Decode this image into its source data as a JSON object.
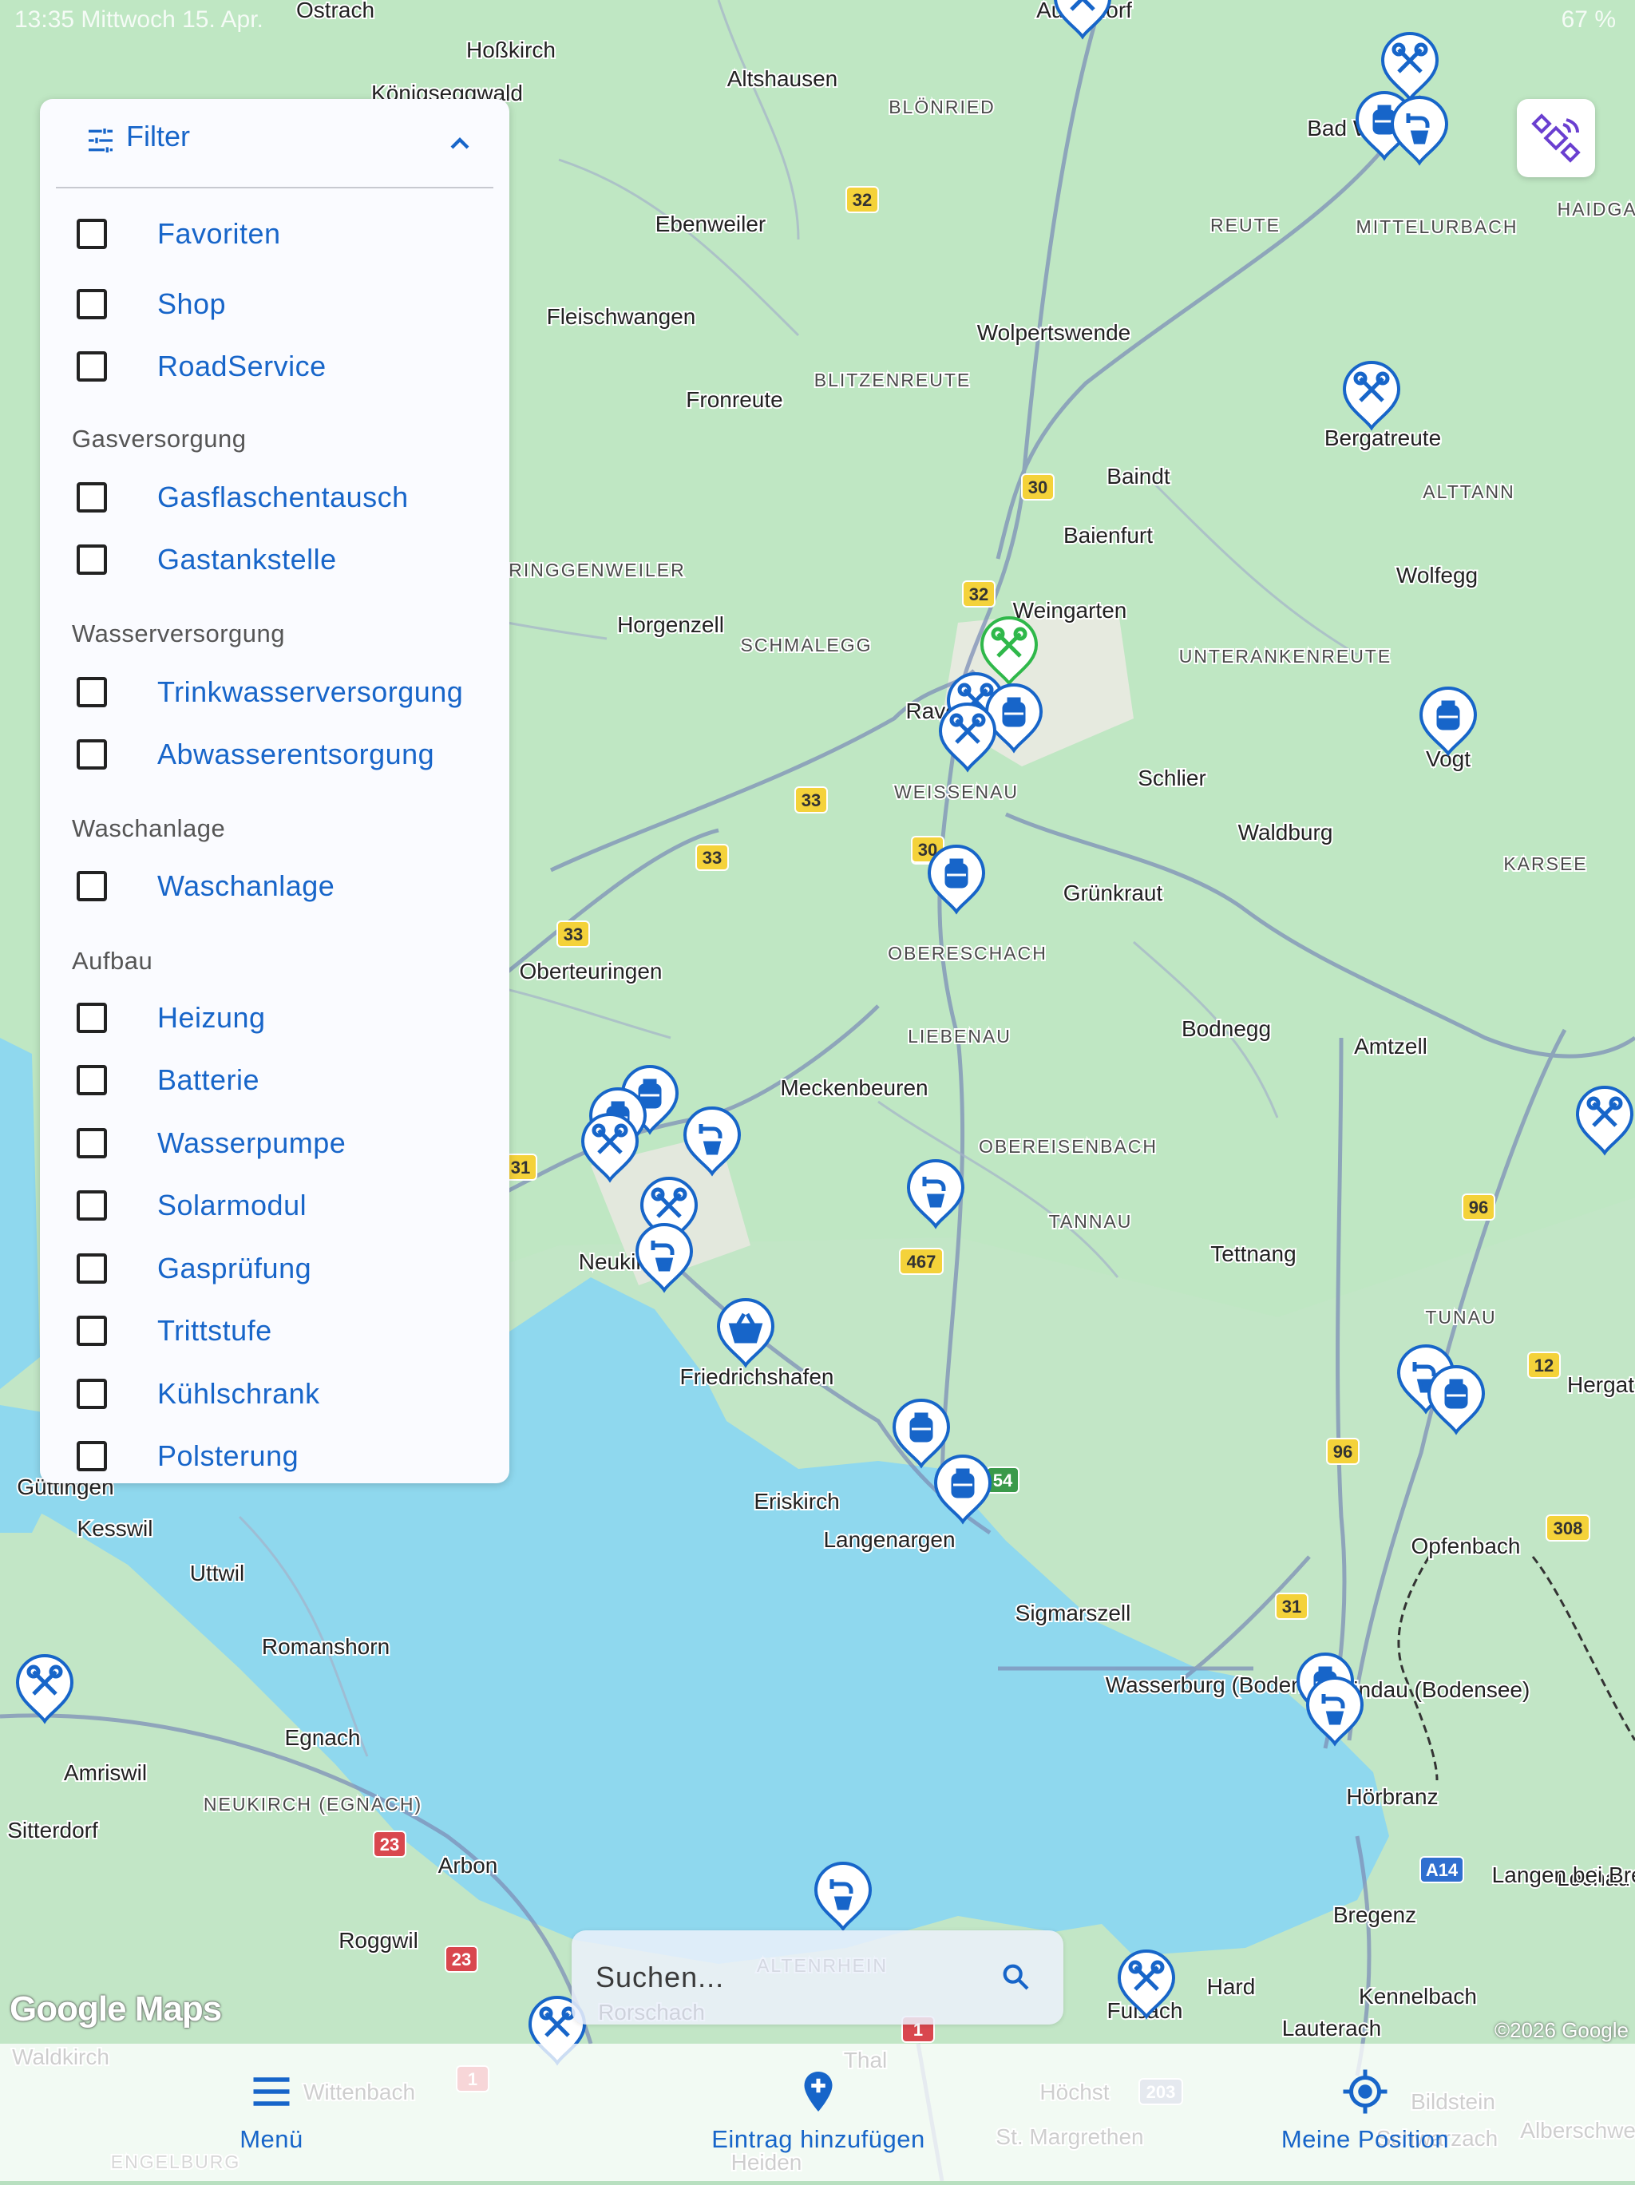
{
  "status_bar": {
    "time": "13:35",
    "date": "Mittwoch 15. Apr.",
    "battery": "67 %"
  },
  "filter": {
    "title": "Filter",
    "items_top": [
      {
        "label": "Favoriten",
        "checked": false
      },
      {
        "label": "Shop",
        "checked": false
      },
      {
        "label": "RoadService",
        "checked": false
      }
    ],
    "sections": [
      {
        "title": "Gasversorgung",
        "items": [
          {
            "label": "Gasflaschentausch",
            "checked": false
          },
          {
            "label": "Gastankstelle",
            "checked": false
          }
        ]
      },
      {
        "title": "Wasserversorgung",
        "items": [
          {
            "label": "Trinkwasserversorgung",
            "checked": false
          },
          {
            "label": "Abwasserentsorgung",
            "checked": false
          }
        ]
      },
      {
        "title": "Waschanlage",
        "items": [
          {
            "label": "Waschanlage",
            "checked": false
          }
        ]
      },
      {
        "title": "Aufbau",
        "items": [
          {
            "label": "Heizung",
            "checked": false
          },
          {
            "label": "Batterie",
            "checked": false
          },
          {
            "label": "Wasserpumpe",
            "checked": false
          },
          {
            "label": "Solarmodul",
            "checked": false
          },
          {
            "label": "Gasprüfung",
            "checked": false
          },
          {
            "label": "Trittstufe",
            "checked": false
          },
          {
            "label": "Kühlschrank",
            "checked": false
          },
          {
            "label": "Polsterung",
            "checked": false
          }
        ]
      }
    ]
  },
  "search": {
    "placeholder": "Suchen..."
  },
  "map": {
    "attribution": "Google Maps",
    "copyright": "©2026 Google",
    "place_labels": [
      "Ostrach",
      "Hoßkirch",
      "Königseggwald",
      "Altshausen",
      "BLÖNRIED",
      "Aulendorf",
      "Bad Waldsee",
      "REUTE",
      "MITTELURBACH",
      "HAIDGAU",
      "Ebenweiler",
      "Fleischwangen",
      "Wolpertswende",
      "BLITZENREUTE",
      "Fronreute",
      "Bergatreute",
      "Baindt",
      "Baienfurt",
      "ALTTANN",
      "Wolfegg",
      "RINGGENWEILER",
      "Horgenzell",
      "SCHMALEGG",
      "Weingarten",
      "UNTERANKENREUTE",
      "Ravensburg",
      "Vogt",
      "WEISSENAU",
      "Schlier",
      "Waldburg",
      "KARSEE",
      "Grünkraut",
      "OBERESCHACH",
      "Oberteuringen",
      "LIEBENAU",
      "Bodnegg",
      "Amtzell",
      "Meckenbeuren",
      "OBEREISENBACH",
      "TANNAU",
      "Tettnang",
      "Neukirch",
      "Friedrichshafen",
      "Eriskirch",
      "Langenargen",
      "TUNAU",
      "Hergatz",
      "Opfenbach",
      "Sigmarszell",
      "Wasserburg (Bodensee)",
      "Lindau (Bodensee)",
      "Hörbranz",
      "Lochau",
      "Kesswil",
      "Uttwil",
      "Romanshorn",
      "Amriswil",
      "Egnach",
      "NEUKIRCH (EGNACH)",
      "Sitterdorf",
      "Arbon",
      "Roggwil",
      "Rorschach",
      "ALTENRHEIN",
      "Bregenz",
      "Hard",
      "Fußach",
      "Kennelbach",
      "Lauterach",
      "Langen bei Bregenz",
      "Güttingen",
      "Waldkirch",
      "Wittenbach",
      "Thal",
      "Höchst",
      "St. Margrethen",
      "Bildstein",
      "Schwarzach",
      "ENGELBURG",
      "Heiden",
      "Alberschwende"
    ],
    "road_shields": [
      "32",
      "30",
      "33",
      "467",
      "31",
      "96",
      "308",
      "12",
      "A14",
      "23",
      "203",
      "1",
      "54"
    ]
  },
  "bottom_nav": {
    "menu": "Menü",
    "add_entry": "Eintrag hinzufügen",
    "my_position": "Meine Position"
  }
}
